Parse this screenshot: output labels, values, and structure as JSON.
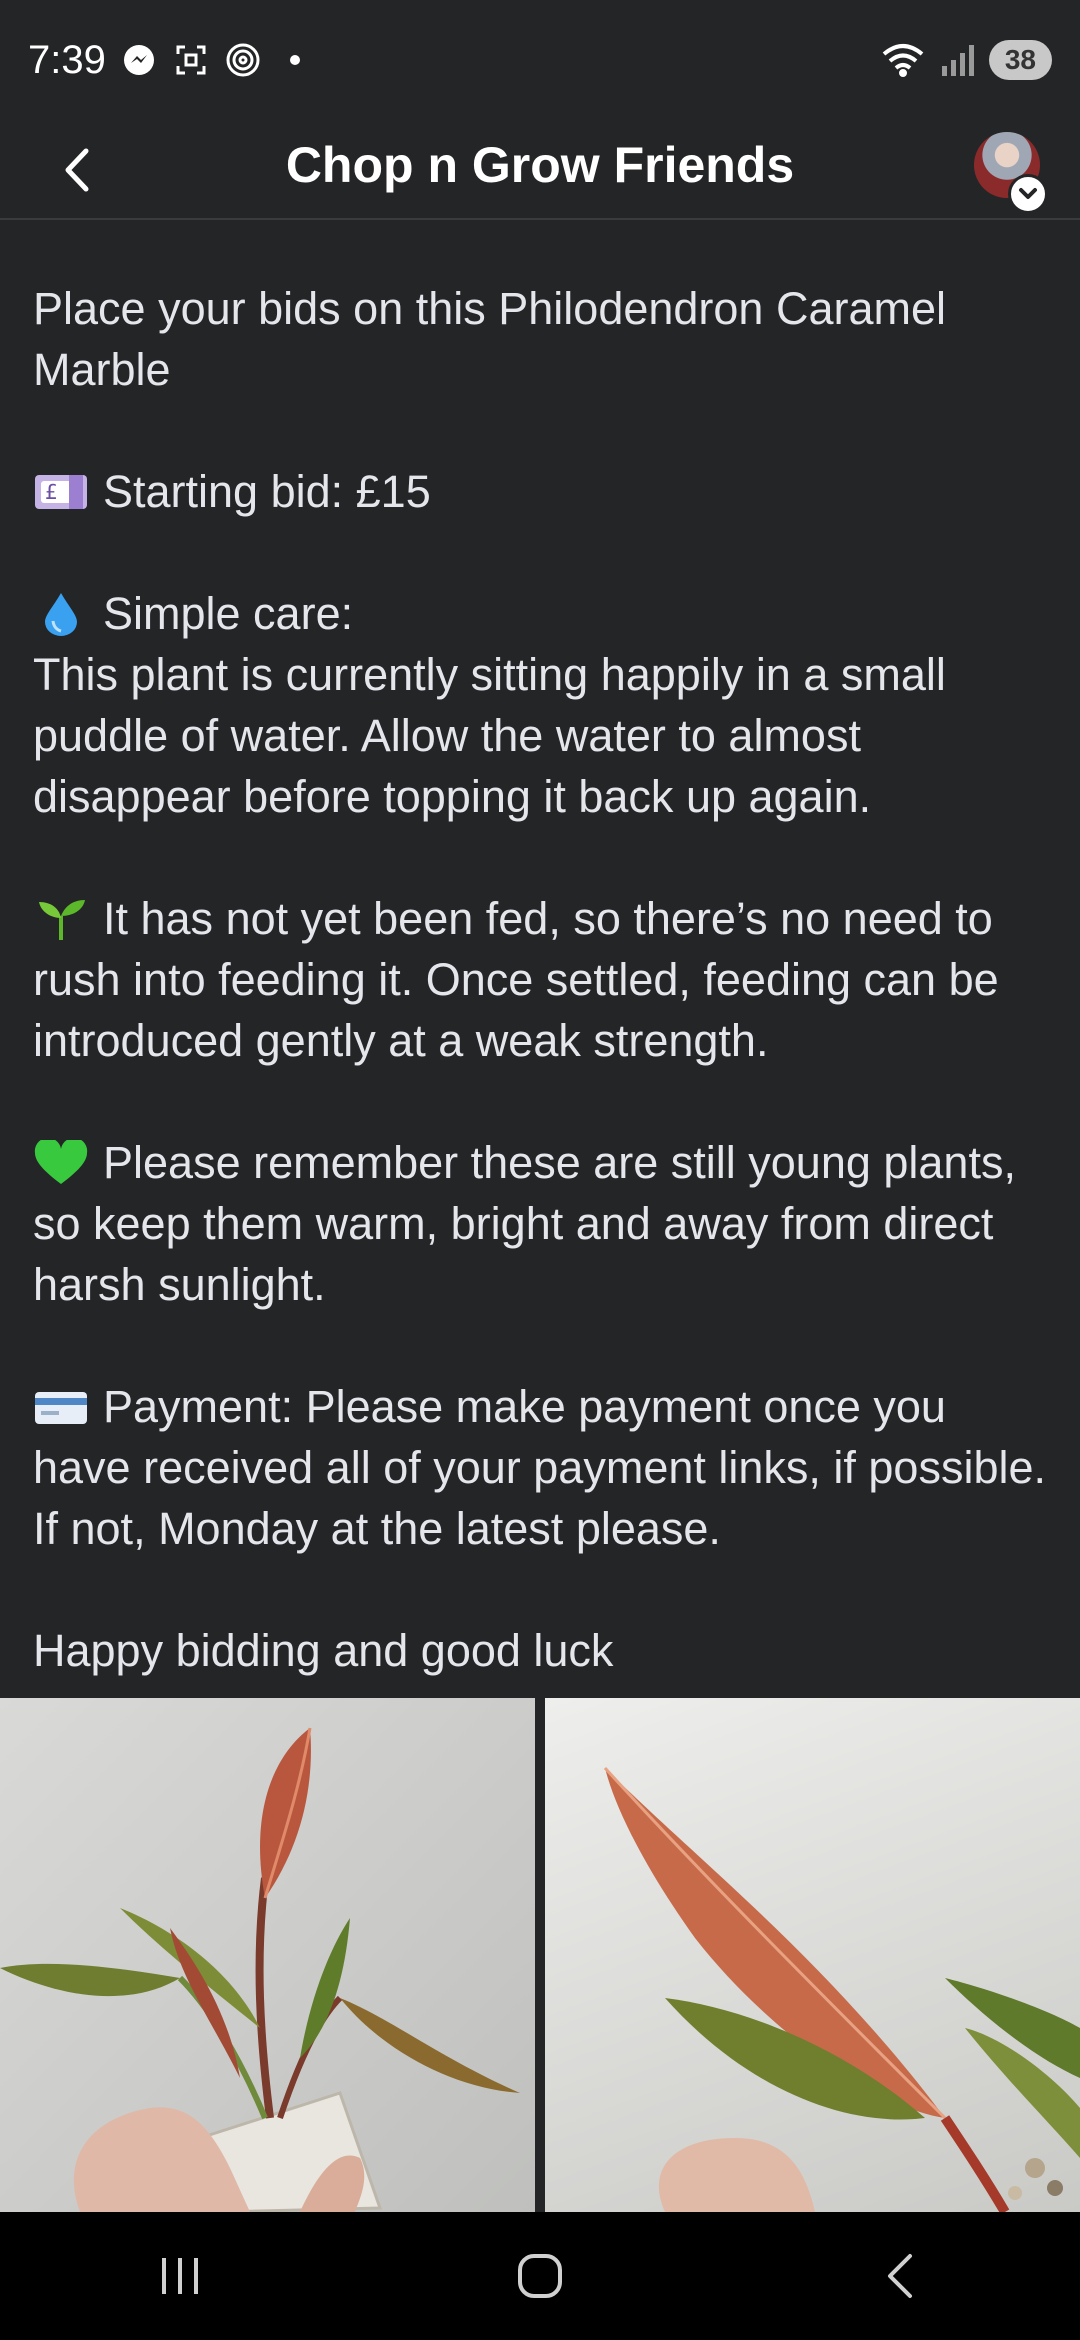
{
  "status_bar": {
    "time": "7:39",
    "battery": "38",
    "icons": [
      "messenger-icon",
      "screenshot-icon",
      "nfc-icon",
      "dot-icon",
      "wifi-icon",
      "signal-icon"
    ]
  },
  "header": {
    "title": "Chop n Grow Friends",
    "back_icon": "chevron-left-icon",
    "avatar_badge_icon": "chevron-down-icon"
  },
  "post": {
    "intro": "Place your bids on this Philodendron Caramel Marble",
    "starting_bid": "Starting bid: £15",
    "care_heading": "Simple care:",
    "care_text": "This plant is currently sitting happily in a small puddle of water. Allow the water to almost disappear before topping it back up again.",
    "feeding": "It has not yet been fed, so there’s no need to rush into feeding it. Once settled, feeding can be introduced gently at a weak strength.",
    "reminder": "Please remember these are still young plants, so keep them warm, bright and away from direct harsh sunlight.",
    "payment": "Payment: Please make payment once you have received all of your payment links, if possible. If not, Monday at the latest please.",
    "closing": "Happy bidding and good luck",
    "emoji_icons": [
      "pound-banknote-icon",
      "droplet-icon",
      "seedling-icon",
      "green-heart-icon",
      "credit-card-icon"
    ]
  },
  "photos": [
    {
      "name": "plant-photo-1"
    },
    {
      "name": "plant-photo-2"
    }
  ],
  "nav_bar": {
    "icons": [
      "recent-apps-icon",
      "home-icon",
      "back-icon"
    ]
  },
  "colors": {
    "background": "#242527",
    "text": "#e4e6eb",
    "nav": "#000000"
  }
}
